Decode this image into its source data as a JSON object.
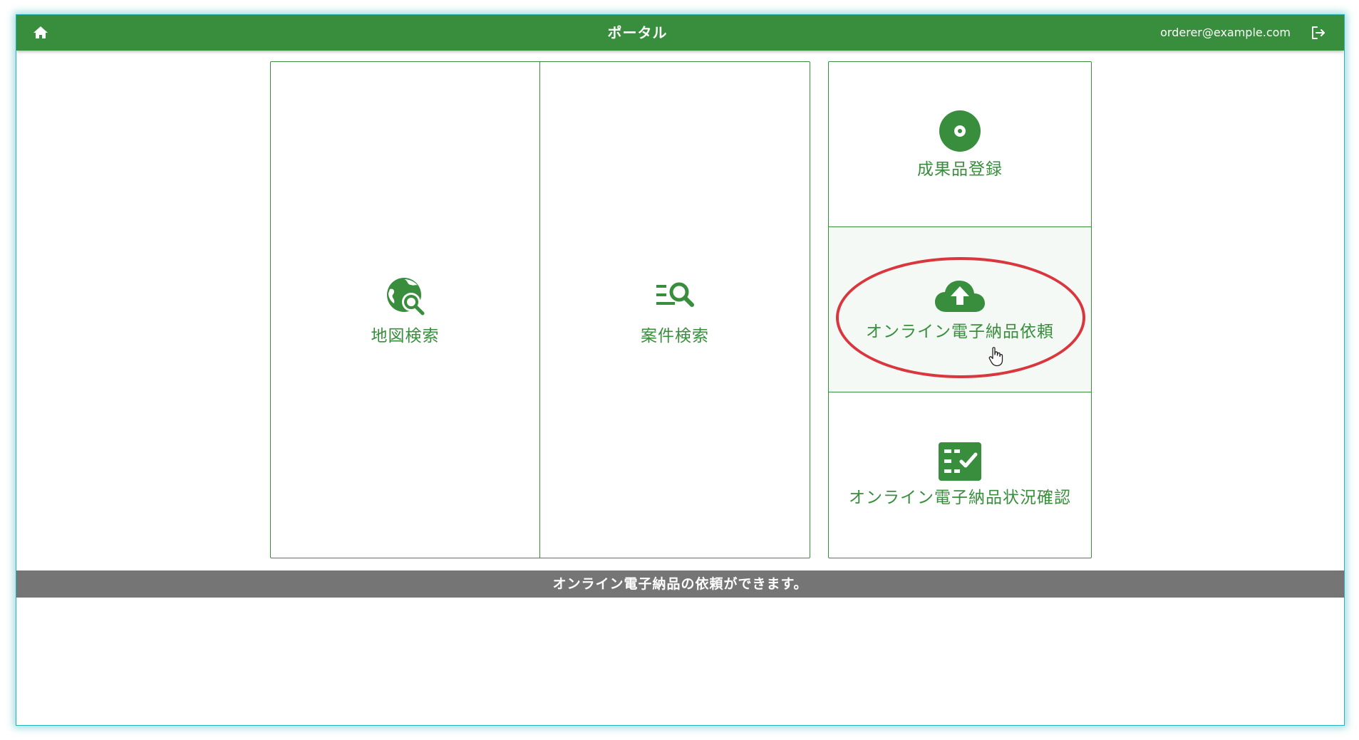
{
  "header": {
    "title": "ポータル",
    "user_email": "orderer@example.com"
  },
  "tiles": {
    "map_search": {
      "label": "地図検索",
      "icon": "map-search-icon"
    },
    "case_search": {
      "label": "案件検索",
      "icon": "list-search-icon"
    },
    "deliverable_registration": {
      "label": "成果品登録",
      "icon": "disc-icon"
    },
    "online_delivery_request": {
      "label": "オンライン電子納品依頼",
      "icon": "cloud-upload-icon"
    },
    "online_delivery_status": {
      "label": "オンライン電子納品状況確認",
      "icon": "checklist-icon"
    }
  },
  "status_bar": {
    "message": "オンライン電子納品の依頼ができます。"
  },
  "colors": {
    "primary": "#388e3c",
    "status_bar": "#757575",
    "highlight": "#d9363e",
    "window_border": "#2ab0b8"
  }
}
